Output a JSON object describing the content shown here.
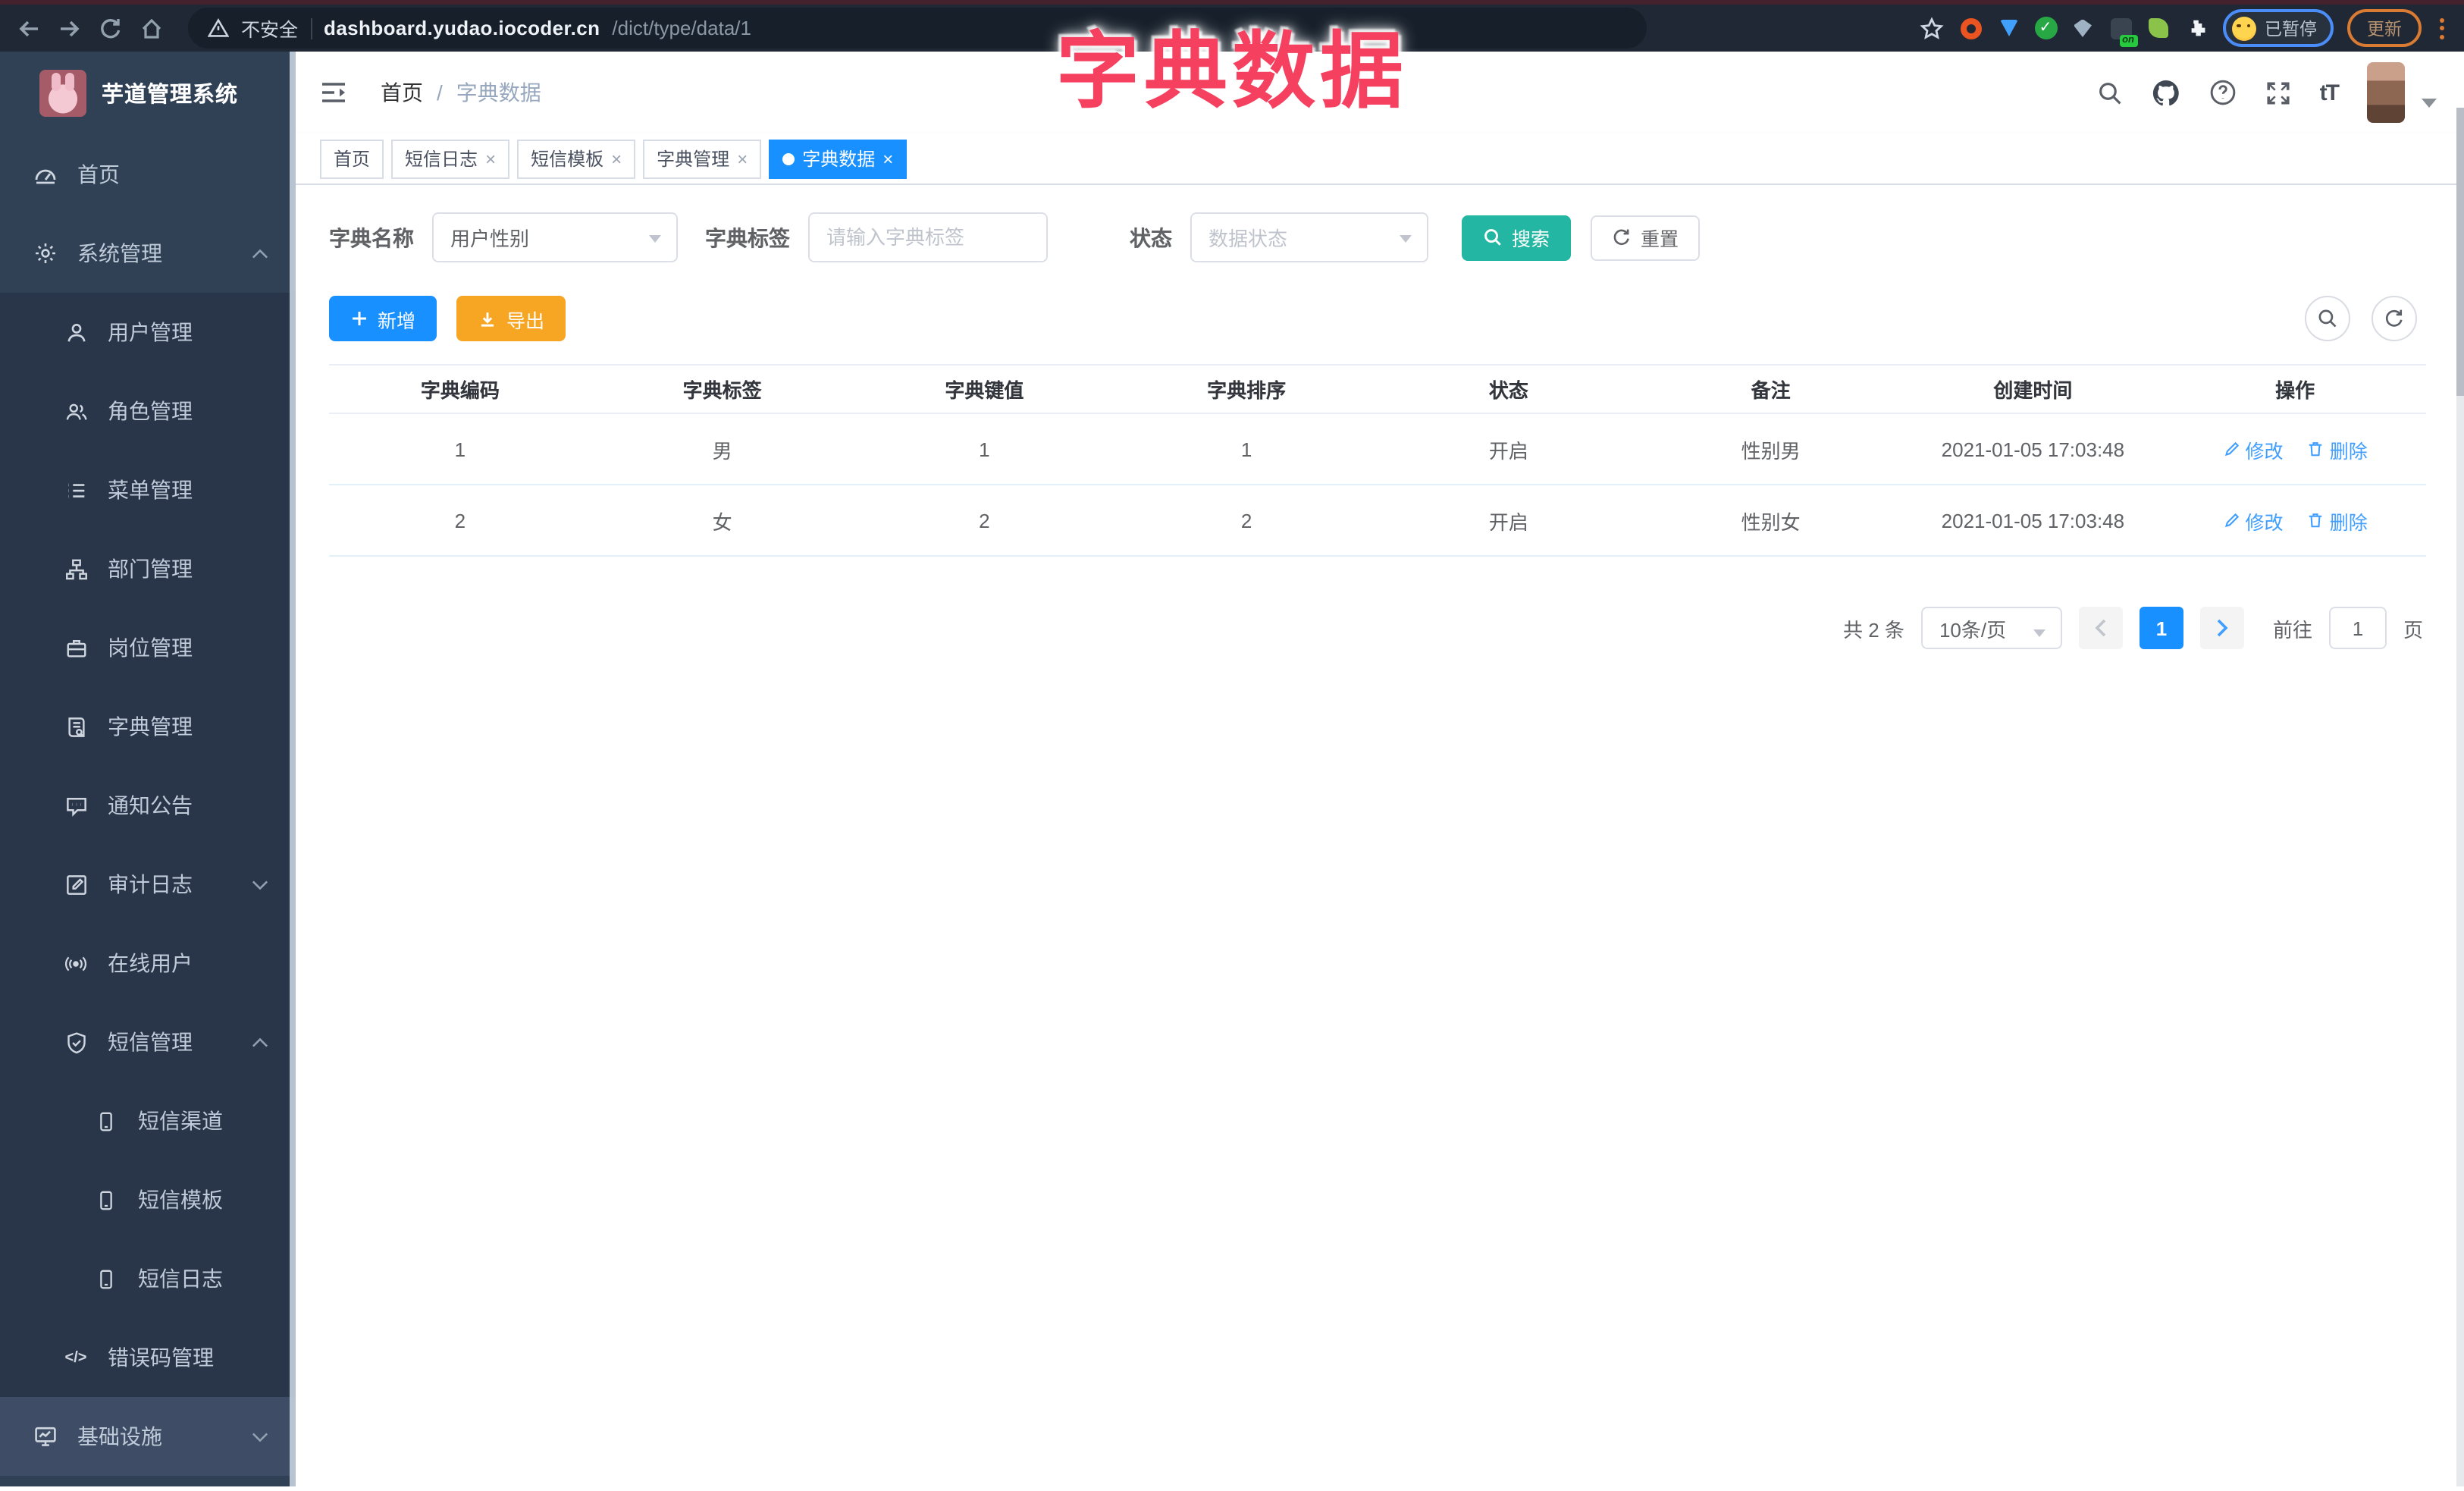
{
  "browser": {
    "security_warning": "不安全",
    "url_domain": "dashboard.yudao.iocoder.cn",
    "url_path": "/dict/type/data/1",
    "extension_on_badge": "on",
    "profile_status": "已暂停",
    "update_button": "更新"
  },
  "overlay_title": "字典数据",
  "sidebar": {
    "logo_title": "芋道管理系统",
    "items": [
      {
        "label": "首页"
      },
      {
        "label": "系统管理"
      },
      {
        "label": "用户管理"
      },
      {
        "label": "角色管理"
      },
      {
        "label": "菜单管理"
      },
      {
        "label": "部门管理"
      },
      {
        "label": "岗位管理"
      },
      {
        "label": "字典管理"
      },
      {
        "label": "通知公告"
      },
      {
        "label": "审计日志"
      },
      {
        "label": "在线用户"
      },
      {
        "label": "短信管理"
      },
      {
        "label": "短信渠道"
      },
      {
        "label": "短信模板"
      },
      {
        "label": "短信日志"
      },
      {
        "label": "错误码管理"
      },
      {
        "label": "基础设施"
      }
    ]
  },
  "header": {
    "breadcrumb": [
      "首页",
      "字典数据"
    ],
    "breadcrumb_separator": "/",
    "font_size_glyph": "tT"
  },
  "tabs": [
    {
      "label": "首页",
      "closable": false,
      "active": false
    },
    {
      "label": "短信日志",
      "closable": true,
      "active": false
    },
    {
      "label": "短信模板",
      "closable": true,
      "active": false
    },
    {
      "label": "字典管理",
      "closable": true,
      "active": false
    },
    {
      "label": "字典数据",
      "closable": true,
      "active": true
    }
  ],
  "tab_close_glyph": "×",
  "filters": {
    "dict_name_label": "字典名称",
    "dict_name_value": "用户性别",
    "dict_label_label": "字典标签",
    "dict_label_placeholder": "请输入字典标签",
    "status_label": "状态",
    "status_placeholder": "数据状态",
    "search_button": "搜索",
    "reset_button": "重置"
  },
  "toolbar": {
    "add_button": "新增",
    "export_button": "导出"
  },
  "table": {
    "headers": [
      "字典编码",
      "字典标签",
      "字典键值",
      "字典排序",
      "状态",
      "备注",
      "创建时间",
      "操作"
    ],
    "rows": [
      {
        "code": "1",
        "label": "男",
        "value": "1",
        "sort": "1",
        "status": "开启",
        "remark": "性别男",
        "created": "2021-01-05 17:03:48"
      },
      {
        "code": "2",
        "label": "女",
        "value": "2",
        "sort": "2",
        "status": "开启",
        "remark": "性别女",
        "created": "2021-01-05 17:03:48"
      }
    ],
    "action_edit": "修改",
    "action_delete": "删除"
  },
  "pagination": {
    "total_text": "共 2 条",
    "page_size": "10条/页",
    "current_page": "1",
    "goto_label": "前往",
    "goto_value": "1",
    "page_unit": "页"
  },
  "icons_glyphs": {
    "code_icon_glyph": "</>"
  },
  "colors": {
    "accent_blue": "#1890ff",
    "link_blue": "#409eff",
    "search_teal": "#23b7a3",
    "export_orange": "#f6a623",
    "sidebar_bg": "#304156",
    "overlay_pink": "#f5415f"
  }
}
